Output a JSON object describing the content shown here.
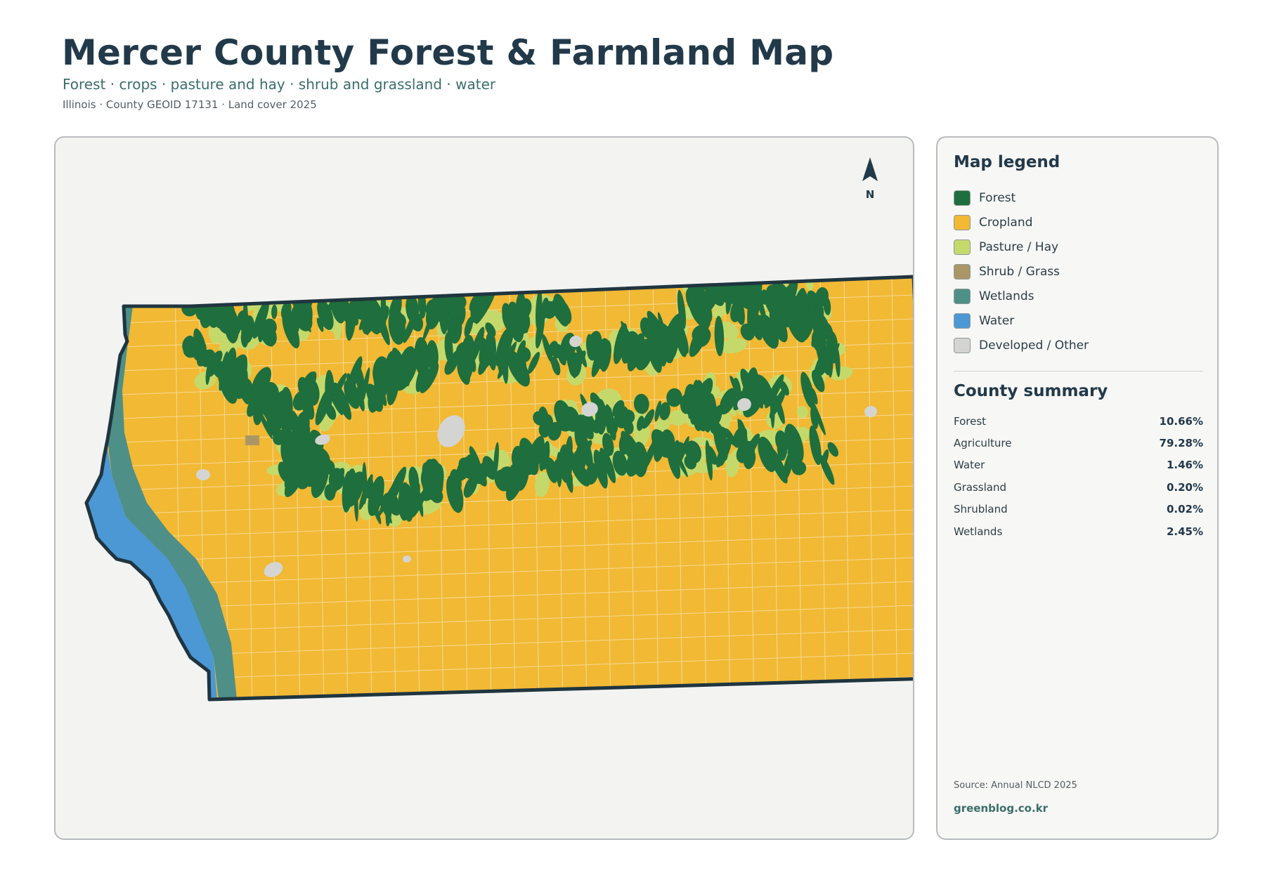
{
  "header": {
    "title": "Mercer County Forest & Farmland Map",
    "subtitle": "Forest · crops · pasture and hay · shrub and grassland · water",
    "meta": "Illinois · County GEOID 17131 · Land cover 2025"
  },
  "map": {
    "north_label": "N",
    "colors": {
      "forest": "#1f6e3d",
      "cropland": "#f1b934",
      "pasture": "#c5d96b",
      "shrub": "#ab9766",
      "wetlands": "#4e8f87",
      "water": "#4b98d4",
      "developed": "#d4d4d2",
      "outline": "#1f3540",
      "background": "#f3f3f1"
    }
  },
  "legend": {
    "title": "Map legend",
    "items": [
      {
        "label": "Forest",
        "color": "#1f6e3d"
      },
      {
        "label": "Cropland",
        "color": "#f1b934"
      },
      {
        "label": "Pasture / Hay",
        "color": "#c5d96b"
      },
      {
        "label": "Shrub / Grass",
        "color": "#ab9766"
      },
      {
        "label": "Wetlands",
        "color": "#4e8f87"
      },
      {
        "label": "Water",
        "color": "#4b98d4"
      },
      {
        "label": "Developed / Other",
        "color": "#d4d4d2"
      }
    ]
  },
  "summary": {
    "title": "County summary",
    "rows": [
      {
        "label": "Forest",
        "value": "10.66%"
      },
      {
        "label": "Agriculture",
        "value": "79.28%"
      },
      {
        "label": "Water",
        "value": "1.46%"
      },
      {
        "label": "Grassland",
        "value": "0.20%"
      },
      {
        "label": "Shrubland",
        "value": "0.02%"
      },
      {
        "label": "Wetlands",
        "value": "2.45%"
      }
    ]
  },
  "footer": {
    "source": "Source: Annual NLCD 2025",
    "site": "greenblog.co.kr"
  }
}
